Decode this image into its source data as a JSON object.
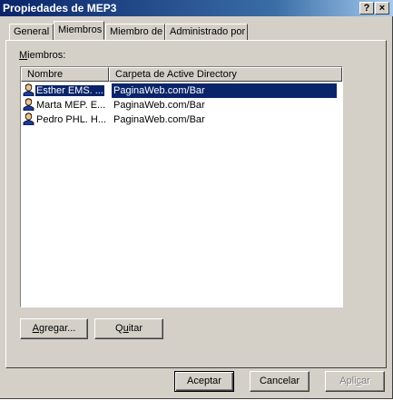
{
  "window": {
    "title": "Propiedades de MEP3",
    "help_label": "?",
    "close_label": "×"
  },
  "tabs": [
    {
      "label": "General"
    },
    {
      "label": "Miembros"
    },
    {
      "label": "Miembro de"
    },
    {
      "label": "Administrado por"
    }
  ],
  "members": {
    "label_prefix": "M",
    "label_rest": "iembros:",
    "columns": [
      "Nombre",
      "Carpeta de Active Directory"
    ],
    "rows": [
      {
        "name": "Esther EMS. ...",
        "folder": "PaginaWeb.com/Bar",
        "selected": true,
        "icon": "user-icon"
      },
      {
        "name": "Marta MEP. E...",
        "folder": "PaginaWeb.com/Bar",
        "selected": false,
        "icon": "user-icon"
      },
      {
        "name": "Pedro PHL. H...",
        "folder": "PaginaWeb.com/Bar",
        "selected": false,
        "icon": "user-icon"
      }
    ]
  },
  "buttons": {
    "add": {
      "prefix": "A",
      "rest": "gregar..."
    },
    "remove": {
      "pre": "Q",
      "mid": "u",
      "rest": "itar"
    },
    "ok": "Aceptar",
    "cancel": "Cancelar",
    "apply": {
      "pre": "Apli",
      "mid": "c",
      "rest": "ar"
    }
  },
  "colors": {
    "selection": "#0a246a",
    "face": "#d4d0c8"
  }
}
